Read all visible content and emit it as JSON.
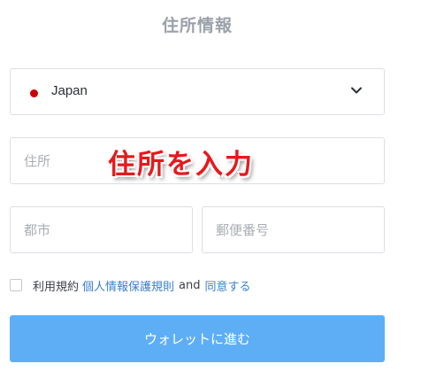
{
  "header": {
    "title": "住所情報"
  },
  "country_select": {
    "selected": "Japan",
    "flag_color": "#cc0000",
    "icon": "chevron-down-icon"
  },
  "address": {
    "placeholder": "住所",
    "value": ""
  },
  "city": {
    "placeholder": "都市",
    "value": ""
  },
  "postal_code": {
    "placeholder": "郵便番号",
    "value": ""
  },
  "annotation": {
    "text": "住所を入力",
    "color": "#e8181c"
  },
  "terms": {
    "prefix": "利用規約",
    "privacy_link": "個人情報保護規則",
    "conjunction": "and",
    "agree_link": "同意する",
    "checked": false
  },
  "submit": {
    "label": "ウォレットに進む",
    "color": "#5eaef6"
  }
}
